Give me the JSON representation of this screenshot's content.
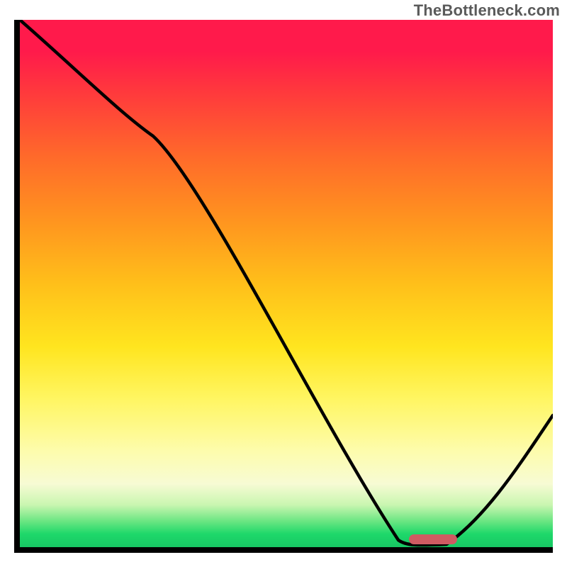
{
  "watermark": "TheBottleneck.com",
  "chart_data": {
    "type": "line",
    "title": "",
    "xlabel": "",
    "ylabel": "",
    "xlim": [
      0,
      100
    ],
    "ylim": [
      0,
      100
    ],
    "x": [
      0,
      25,
      72,
      80,
      100
    ],
    "y": [
      100,
      78,
      1,
      1,
      25
    ],
    "background_gradient": {
      "top": "#ff1a4b",
      "mid": "#ffe51f",
      "bottom": "#17c763"
    },
    "marker": {
      "x_range": [
        73,
        82
      ],
      "y": 1,
      "color": "#cf5b62"
    },
    "annotations": []
  },
  "colors": {
    "axis": "#000000",
    "curve": "#000000",
    "marker": "#cf5b62",
    "watermark": "#5a5a5a"
  }
}
